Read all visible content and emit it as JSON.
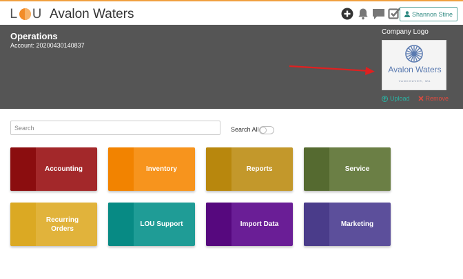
{
  "app": {
    "logo_letters": [
      "L",
      "U"
    ],
    "title": "Avalon Waters"
  },
  "user": {
    "name": "Shannon Stine"
  },
  "top_icons": [
    "add-circle-icon",
    "bell-icon",
    "chat-icon",
    "checkbox-icon"
  ],
  "header": {
    "title": "Operations",
    "account_label": "Account:",
    "account_number": "20200430140837",
    "company_logo_label": "Company Logo",
    "logo_image": {
      "name": "Avalon Waters",
      "subtitle": "VANCOUVER, WA"
    },
    "upload_label": "Upload",
    "remove_label": "Remove"
  },
  "search": {
    "placeholder": "Search",
    "value": "",
    "search_all_label": "Search All",
    "search_all_on": false
  },
  "tiles": [
    {
      "label": "Accounting",
      "color": "#a3282a",
      "stripe": "#8b0d0f"
    },
    {
      "label": "Inventory",
      "color": "#f7941d",
      "stripe": "#f28300"
    },
    {
      "label": "Reports",
      "color": "#c3982b",
      "stripe": "#b8870d"
    },
    {
      "label": "Service",
      "color": "#6b7f45",
      "stripe": "#556a30"
    },
    {
      "label": "Recurring Orders",
      "color": "#e1b33b",
      "stripe": "#dba923"
    },
    {
      "label": "LOU Support",
      "color": "#1f9c96",
      "stripe": "#078a84"
    },
    {
      "label": "Import Data",
      "color": "#6a1e96",
      "stripe": "#56087e"
    },
    {
      "label": "Marketing",
      "color": "#5c4f9b",
      "stripe": "#4a3c8a"
    }
  ],
  "colors": {
    "accent": "#f28c28",
    "header_bg": "#555555",
    "teal": "#2ab3a3",
    "red": "#e14a3f"
  }
}
